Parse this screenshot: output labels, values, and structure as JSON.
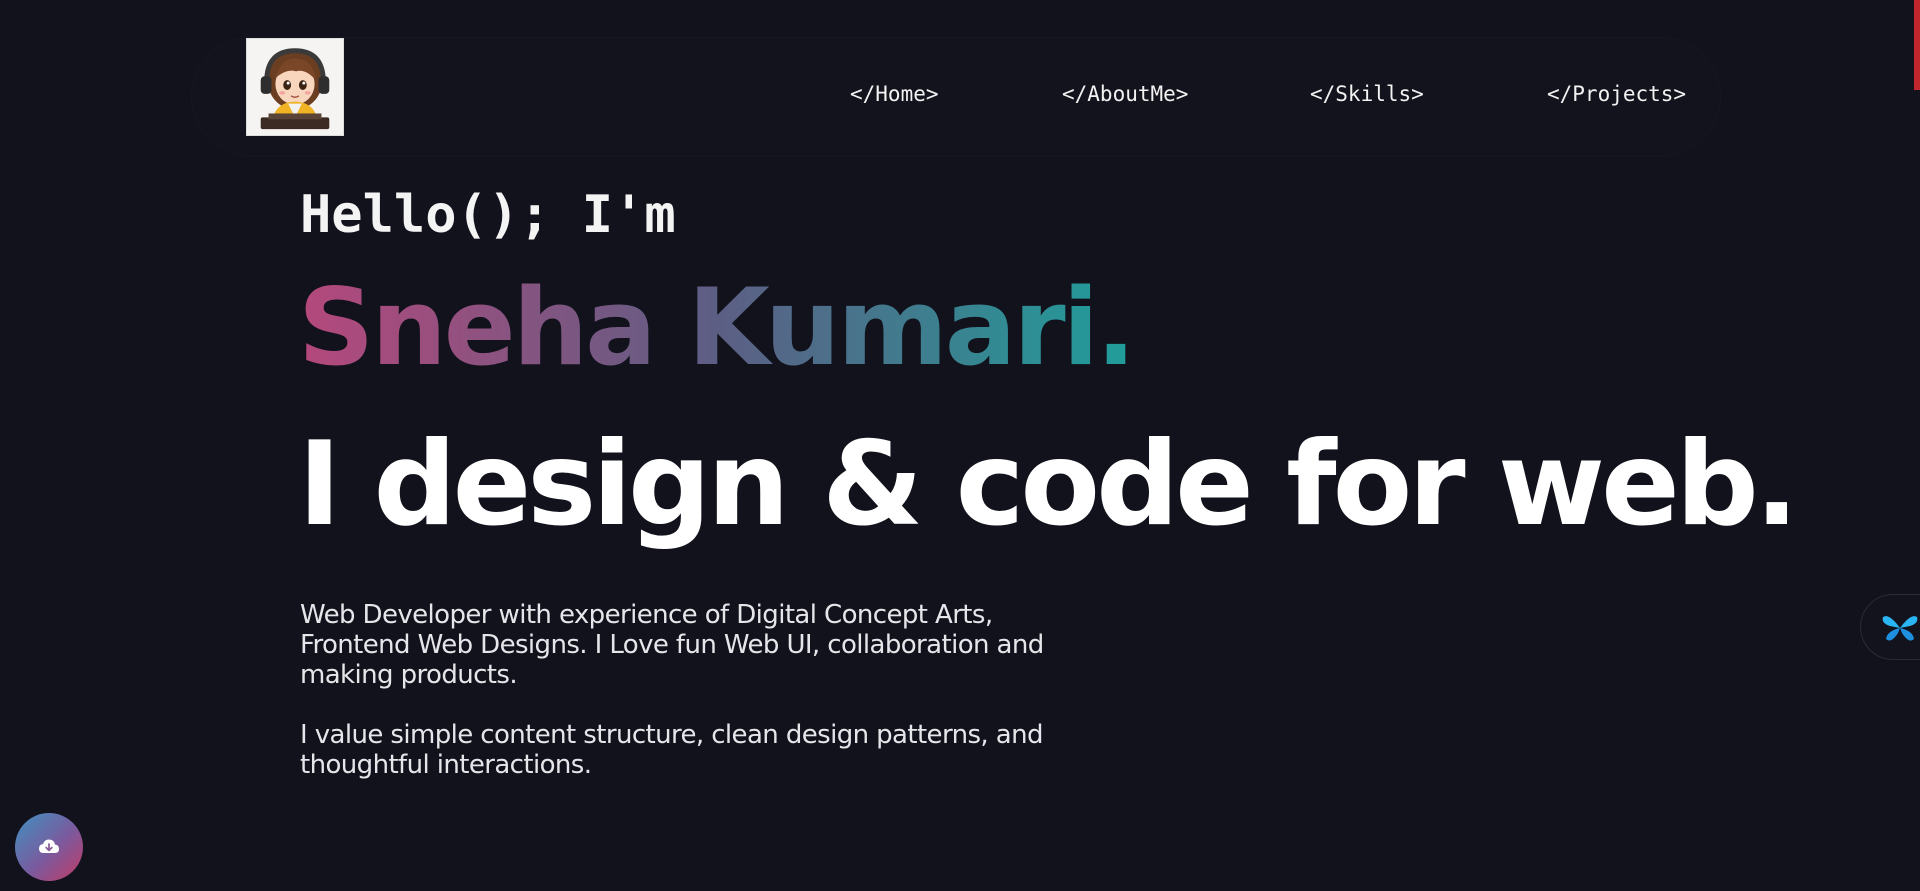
{
  "nav": {
    "items": [
      {
        "label": "</Home>"
      },
      {
        "label": "</AboutMe>"
      },
      {
        "label": "</Skills>"
      },
      {
        "label": "</Projects>"
      }
    ]
  },
  "hero": {
    "greeting": "Hello(); I'm",
    "name": "Sneha Kumari.",
    "tagline": "I design & code for web.",
    "paragraphs": [
      "Web Developer with experience of Digital Concept Arts, Frontend Web Designs. I Love fun Web UI, collaboration and making products.",
      "I value simple content structure, clean design patterns, and thoughtful interactions."
    ]
  },
  "colors": {
    "background": "#12121c",
    "name_gradient_start": "#b5487c",
    "name_gradient_mid": "#5d5e84",
    "name_gradient_end": "#1f9e9a",
    "scroll_indicator": "#c1272d"
  },
  "icons": {
    "logo": "avatar-girl-headphones-icon",
    "side_widget": "butterfly-icon",
    "download": "cloud-download-icon"
  }
}
